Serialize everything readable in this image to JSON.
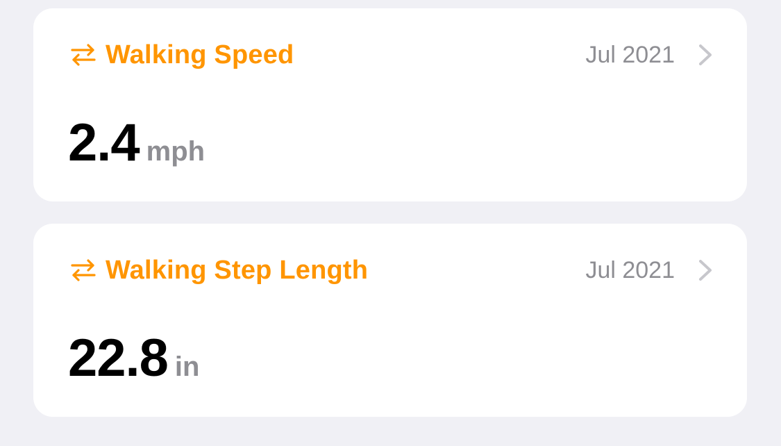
{
  "colors": {
    "background": "#f0f0f5",
    "card": "#ffffff",
    "accent": "#ff9500",
    "secondary_text": "#8e8e93",
    "chevron": "#c7c7cc"
  },
  "cards": [
    {
      "icon": "mobility-arrows-icon",
      "title": "Walking Speed",
      "date": "Jul 2021",
      "value": "2.4",
      "unit": "mph"
    },
    {
      "icon": "mobility-arrows-icon",
      "title": "Walking Step Length",
      "date": "Jul 2021",
      "value": "22.8",
      "unit": "in"
    }
  ]
}
